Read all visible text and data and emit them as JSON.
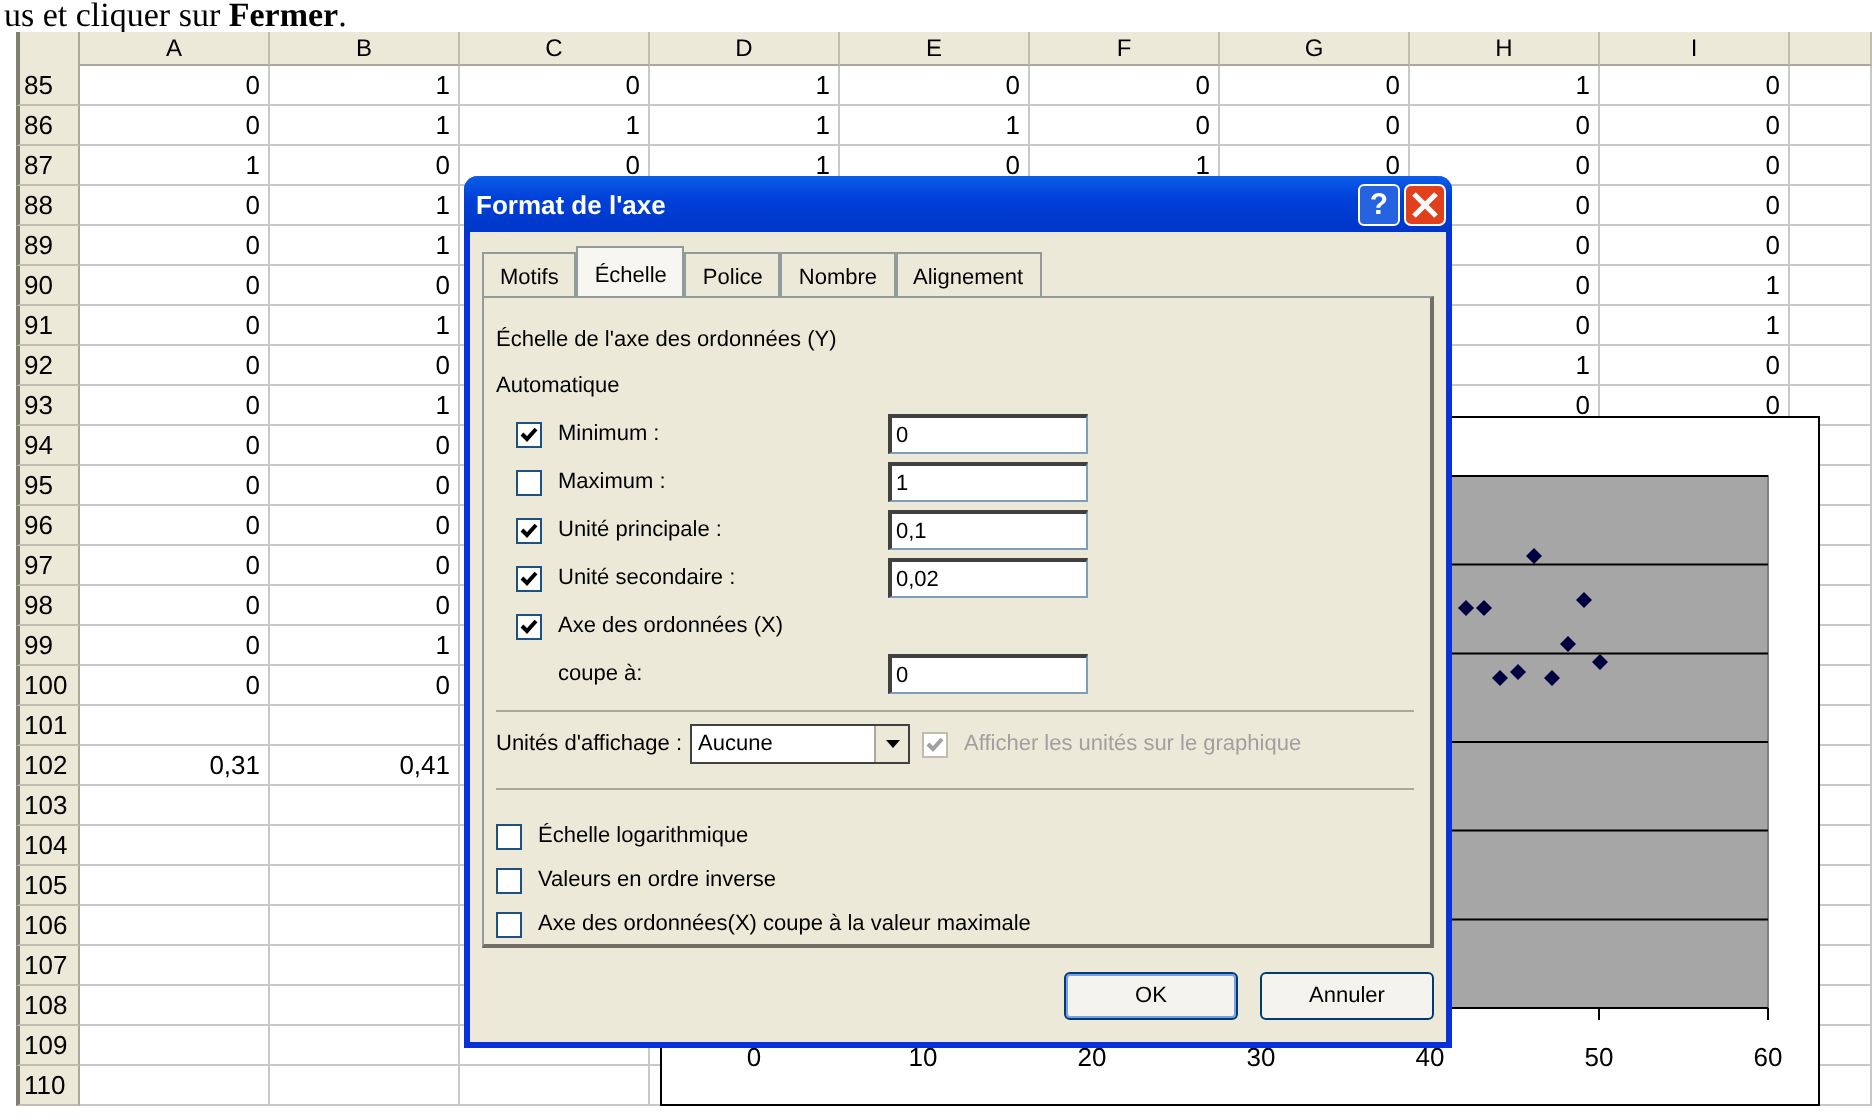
{
  "caption": "us et cliquer sur **Fermer**.",
  "columns": [
    "A",
    "B",
    "C",
    "D",
    "E",
    "F",
    "G",
    "H",
    "I"
  ],
  "rows": [
    {
      "number": "85",
      "cells": [
        "0",
        "1",
        "0",
        "1",
        "0",
        "0",
        "0",
        "1",
        "0"
      ]
    },
    {
      "number": "86",
      "cells": [
        "0",
        "1",
        "1",
        "1",
        "1",
        "0",
        "0",
        "0",
        "0"
      ]
    },
    {
      "number": "87",
      "cells": [
        "1",
        "0",
        "0",
        "1",
        "0",
        "1",
        "0",
        "0",
        "0"
      ]
    },
    {
      "number": "88",
      "cells": [
        "0",
        "1",
        null,
        null,
        null,
        null,
        null,
        "0",
        "0"
      ]
    },
    {
      "number": "89",
      "cells": [
        "0",
        "1",
        null,
        null,
        null,
        null,
        null,
        "0",
        "0"
      ]
    },
    {
      "number": "90",
      "cells": [
        "0",
        "0",
        null,
        null,
        null,
        null,
        null,
        "0",
        "1"
      ]
    },
    {
      "number": "91",
      "cells": [
        "0",
        "1",
        null,
        null,
        null,
        null,
        null,
        "0",
        "1"
      ]
    },
    {
      "number": "92",
      "cells": [
        "0",
        "0",
        null,
        null,
        null,
        null,
        null,
        "1",
        "0"
      ]
    },
    {
      "number": "93",
      "cells": [
        "0",
        "1",
        null,
        null,
        null,
        null,
        null,
        "0",
        "0"
      ]
    },
    {
      "number": "94",
      "cells": [
        "0",
        "0"
      ]
    },
    {
      "number": "95",
      "cells": [
        "0",
        "0"
      ]
    },
    {
      "number": "96",
      "cells": [
        "0",
        "0"
      ]
    },
    {
      "number": "97",
      "cells": [
        "0",
        "0"
      ]
    },
    {
      "number": "98",
      "cells": [
        "0",
        "0"
      ]
    },
    {
      "number": "99",
      "cells": [
        "0",
        "1"
      ]
    },
    {
      "number": "100",
      "cells": [
        "0",
        "0"
      ]
    },
    {
      "number": "101",
      "cells": []
    },
    {
      "number": "102",
      "cells": [
        "0,31",
        "0,41"
      ]
    },
    {
      "number": "103",
      "cells": []
    },
    {
      "number": "104",
      "cells": []
    },
    {
      "number": "105",
      "cells": []
    },
    {
      "number": "106",
      "cells": []
    },
    {
      "number": "107",
      "cells": []
    },
    {
      "number": "108",
      "cells": []
    },
    {
      "number": "109",
      "cells": []
    },
    {
      "number": "110",
      "cells": []
    }
  ],
  "chart": {
    "x_tick_labels": [
      "0",
      "10",
      "20",
      "30",
      "40",
      "50",
      "60"
    ]
  },
  "dialog": {
    "title": "Format de l'axe",
    "help_button": "?",
    "tabs": [
      {
        "label": "Motifs",
        "selected": false
      },
      {
        "label": "Échelle",
        "selected": true
      },
      {
        "label": "Police",
        "selected": false
      },
      {
        "label": "Nombre",
        "selected": false
      },
      {
        "label": "Alignement",
        "selected": false
      }
    ],
    "heading": "Échelle de l'axe des ordonnées (Y)",
    "group_label": "Automatique",
    "scale_rows": [
      {
        "kind": "check_field",
        "label": "Minimum :",
        "checked": true,
        "value": "0"
      },
      {
        "kind": "check_field",
        "label": "Maximum :",
        "checked": false,
        "value": "1"
      },
      {
        "kind": "check_field",
        "label": "Unité principale :",
        "checked": true,
        "value": "0,1"
      },
      {
        "kind": "check_field",
        "label": "Unité secondaire :",
        "checked": true,
        "value": "0,02"
      },
      {
        "kind": "check",
        "label": "Axe des ordonnées (X)",
        "checked": true
      },
      {
        "kind": "field",
        "label": "coupe à:",
        "value": "0"
      }
    ],
    "display_units": {
      "label": "Unités d'affichage :",
      "value": "Aucune",
      "show_label": "Afficher les unités sur le graphique",
      "show_checked": true,
      "show_disabled": true
    },
    "options": [
      {
        "label": "Échelle logarithmique",
        "checked": false
      },
      {
        "label": "Valeurs en ordre inverse",
        "checked": false
      },
      {
        "label": "Axe des ordonnées(X) coupe à la valeur maximale",
        "checked": false
      }
    ],
    "buttons": [
      "OK",
      "Annuler"
    ]
  }
}
